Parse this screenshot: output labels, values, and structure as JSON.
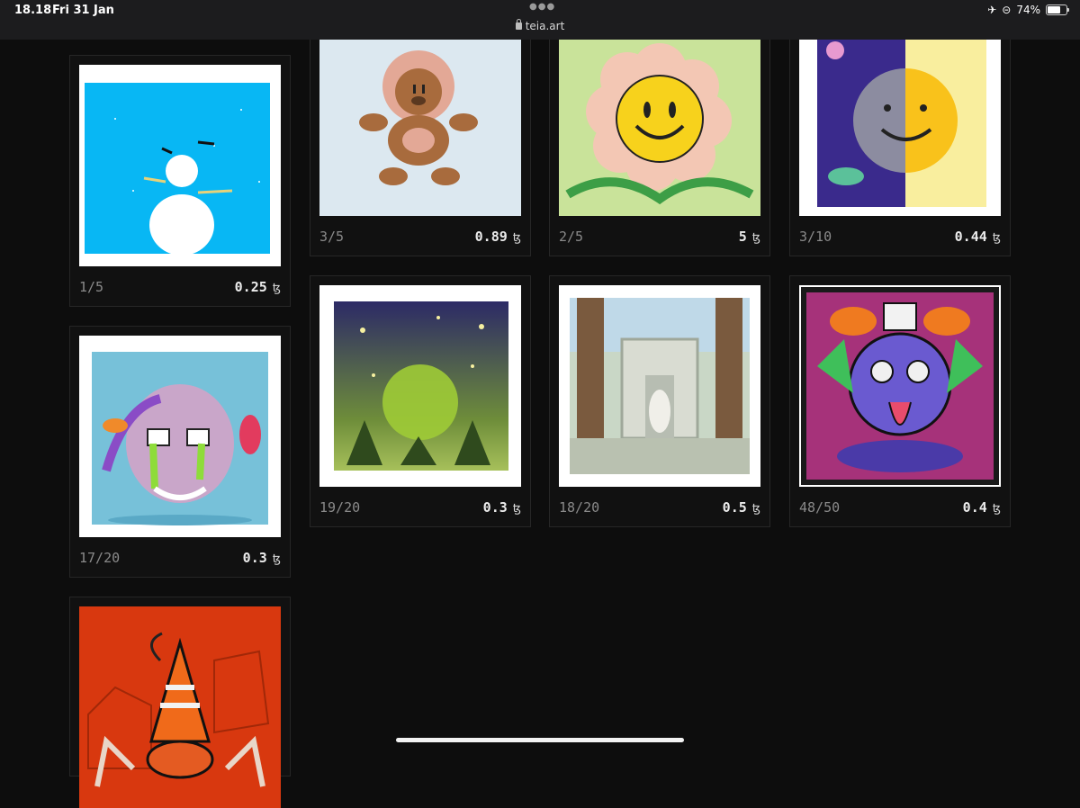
{
  "status_bar": {
    "time": "18.18",
    "date": "Fri 31 Jan",
    "url": "teia.art",
    "battery": "74%",
    "battery_level": 0.74
  },
  "colors": {
    "background": "#0d0d0d",
    "card_border": "#262626",
    "edition_text": "#8a8a8a",
    "price_text": "#ececec"
  },
  "currency_symbol": "ꜩ",
  "cards": [
    {
      "art": "snowman",
      "edition": "1/5",
      "price": "0.25"
    },
    {
      "art": "bear-angel",
      "edition": "3/5",
      "price": "0.89"
    },
    {
      "art": "smiling-flower",
      "edition": "2/5",
      "price": "5"
    },
    {
      "art": "moon-sun",
      "edition": "3/10",
      "price": "0.44"
    },
    {
      "art": "skull-snakes",
      "edition": "17/20",
      "price": "0.3"
    },
    {
      "art": "glowing-orb",
      "edition": "19/20",
      "price": "0.3"
    },
    {
      "art": "forest-temple",
      "edition": "18/20",
      "price": "0.5"
    },
    {
      "art": "mushroom-rat",
      "edition": "48/50",
      "price": "0.4"
    },
    {
      "art": "traffic-cone-spider",
      "edition": "",
      "price": ""
    }
  ]
}
